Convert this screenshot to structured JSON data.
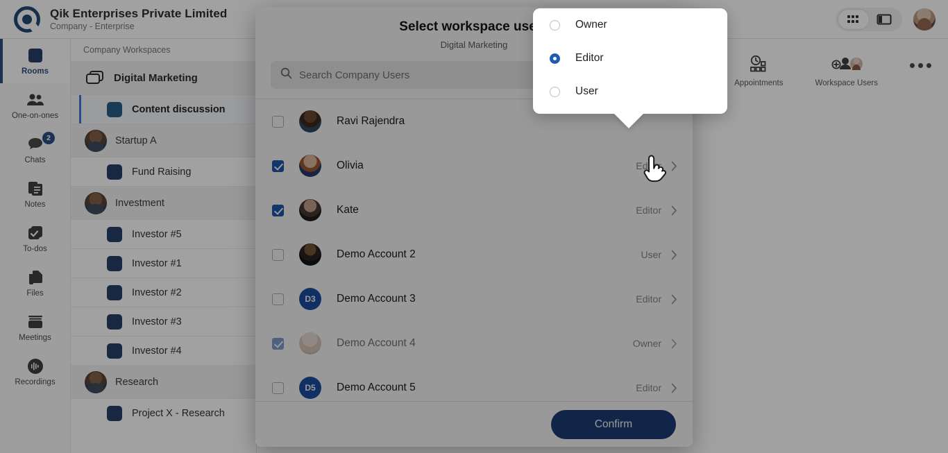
{
  "header": {
    "company_name": "Qik Enterprises Private Limited",
    "company_subtitle": "Company - Enterprise",
    "caret_icon": "chevron-down-icon",
    "grid_view_icon": "grid-view-icon",
    "panel_view_icon": "panel-view-icon",
    "avatar_icon": "user-avatar"
  },
  "rail": {
    "items": [
      {
        "label": "Rooms",
        "icon": "rooms-icon",
        "active": true,
        "badge": ""
      },
      {
        "label": "One-on-ones",
        "icon": "people-icon",
        "active": false,
        "badge": ""
      },
      {
        "label": "Chats",
        "icon": "chat-bubbles-icon",
        "active": false,
        "badge": "2"
      },
      {
        "label": "Notes",
        "icon": "notes-icon",
        "active": false,
        "badge": ""
      },
      {
        "label": "To-dos",
        "icon": "checkbox-stack-icon",
        "active": false,
        "badge": ""
      },
      {
        "label": "Files",
        "icon": "files-icon",
        "active": false,
        "badge": ""
      },
      {
        "label": "Meetings",
        "icon": "meetings-icon",
        "active": false,
        "badge": ""
      },
      {
        "label": "Recordings",
        "icon": "recordings-icon",
        "active": false,
        "badge": ""
      }
    ]
  },
  "workspaces": {
    "section_label": "Company Workspaces",
    "groups": [
      {
        "name": "Digital Marketing",
        "icon": "folders-icon",
        "bold": true,
        "rooms": [
          {
            "name": "Content discussion",
            "selected": true
          }
        ]
      },
      {
        "name": "Startup A",
        "icon": "avatar",
        "bold": false,
        "rooms": [
          {
            "name": "Fund Raising",
            "selected": false
          }
        ]
      },
      {
        "name": "Investment",
        "icon": "avatar",
        "bold": false,
        "rooms": [
          {
            "name": "Investor #5",
            "selected": false
          },
          {
            "name": "Investor #1",
            "selected": false
          },
          {
            "name": "Investor #2",
            "selected": false
          },
          {
            "name": "Investor #3",
            "selected": false
          },
          {
            "name": "Investor #4",
            "selected": false
          }
        ]
      },
      {
        "name": "Research",
        "icon": "avatar",
        "bold": false,
        "rooms": [
          {
            "name": "Project X - Research",
            "selected": false
          }
        ]
      }
    ]
  },
  "main": {
    "badge_count": "0",
    "actions": [
      {
        "label": "Appointments",
        "icon": "appointments-icon"
      },
      {
        "label": "Workspace Users",
        "icon": "workspace-users-icon"
      }
    ],
    "more_icon": "more-horizontal-icon"
  },
  "modal": {
    "title": "Select workspace users",
    "subtitle": "Digital Marketing",
    "search": {
      "placeholder": "Search Company Users",
      "value": "",
      "icon": "search-icon"
    },
    "confirm_label": "Confirm",
    "chevron_icon": "chevron-right-icon",
    "users": [
      {
        "name": "Ravi Rajendra",
        "checked": false,
        "role": "",
        "avatar_kind": "photo",
        "avatar_class": "ph1",
        "initials": "",
        "dim": false
      },
      {
        "name": "Olivia",
        "checked": true,
        "role": "Editor",
        "avatar_kind": "photo",
        "avatar_class": "ph2",
        "initials": "",
        "dim": false
      },
      {
        "name": "Kate",
        "checked": true,
        "role": "Editor",
        "avatar_kind": "photo",
        "avatar_class": "ph3",
        "initials": "",
        "dim": false
      },
      {
        "name": "Demo Account 2",
        "checked": false,
        "role": "User",
        "avatar_kind": "photo",
        "avatar_class": "ph4",
        "initials": "",
        "dim": false
      },
      {
        "name": "Demo Account 3",
        "checked": false,
        "role": "Editor",
        "avatar_kind": "initial",
        "avatar_class": "init",
        "initials": "D3",
        "dim": false
      },
      {
        "name": "Demo Account 4",
        "checked": true,
        "role": "Owner",
        "avatar_kind": "photo",
        "avatar_class": "ph5",
        "initials": "",
        "dim": true
      },
      {
        "name": "Demo Account 5",
        "checked": false,
        "role": "Editor",
        "avatar_kind": "initial",
        "avatar_class": "init",
        "initials": "D5",
        "dim": false
      }
    ]
  },
  "role_dropdown": {
    "options": [
      {
        "label": "Owner",
        "selected": false
      },
      {
        "label": "Editor",
        "selected": true
      },
      {
        "label": "User",
        "selected": false
      }
    ]
  },
  "colors": {
    "brand_navy": "#1d3f78",
    "accent_blue": "#1f5bb5",
    "room_square": "#14305c",
    "selected_room_bar": "#2f6fd0",
    "overlay": "rgba(30,30,30,0.42)"
  }
}
